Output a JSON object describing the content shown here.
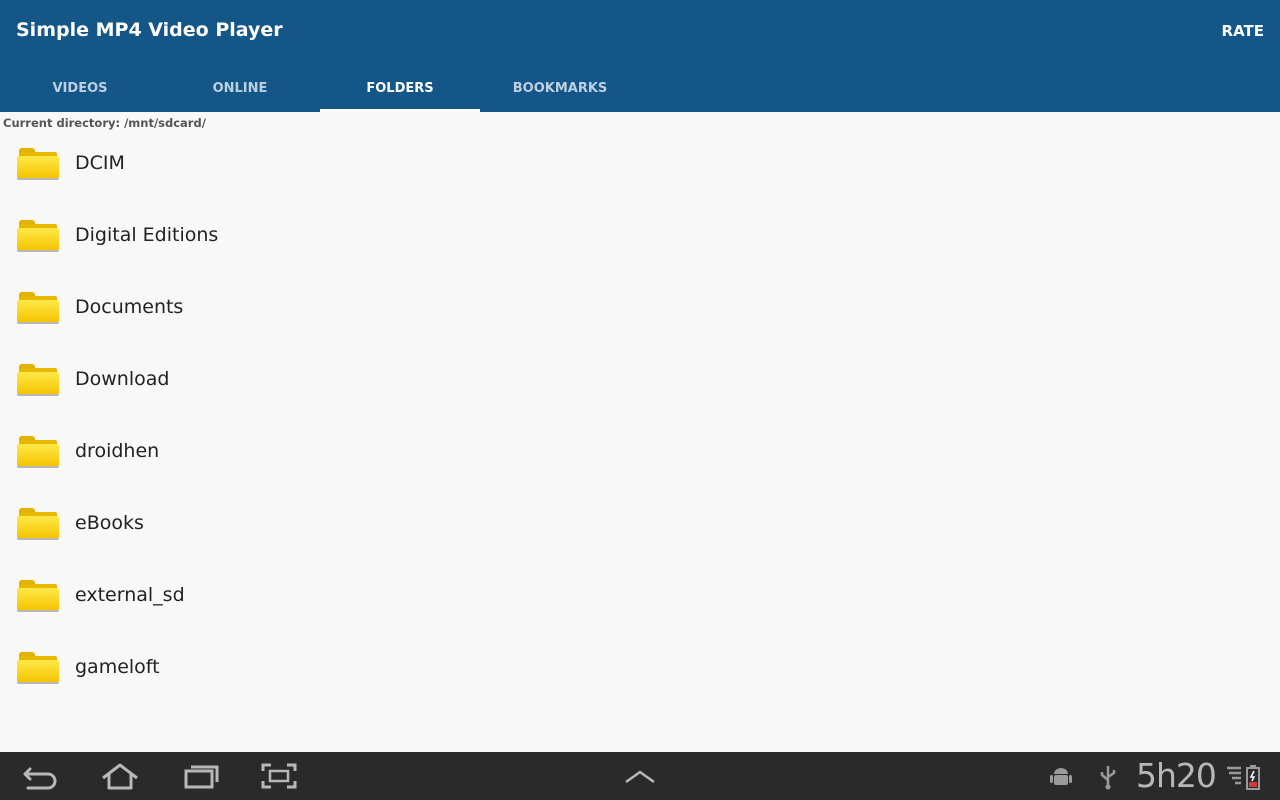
{
  "app": {
    "title": "Simple MP4 Video Player",
    "rate_label": "RATE"
  },
  "tabs": [
    {
      "label": "VIDEOS",
      "active": false
    },
    {
      "label": "ONLINE",
      "active": false
    },
    {
      "label": "FOLDERS",
      "active": true
    },
    {
      "label": "BOOKMARKS",
      "active": false
    }
  ],
  "current_directory": "Current directory: /mnt/sdcard/",
  "folders": [
    {
      "name": "DCIM",
      "icon": "folder-icon"
    },
    {
      "name": "Digital Editions",
      "icon": "folder-icon"
    },
    {
      "name": "Documents",
      "icon": "folder-icon"
    },
    {
      "name": "Download",
      "icon": "folder-icon"
    },
    {
      "name": "droidhen",
      "icon": "folder-icon"
    },
    {
      "name": "eBooks",
      "icon": "folder-icon"
    },
    {
      "name": "external_sd",
      "icon": "folder-icon"
    },
    {
      "name": "gameloft",
      "icon": "folder-icon"
    }
  ],
  "system_bar": {
    "clock": "5h20",
    "icons": [
      "back-icon",
      "home-icon",
      "recent-apps-icon",
      "screenshot-icon",
      "menu-up-icon",
      "android-debug-icon",
      "usb-icon",
      "signal-icon",
      "battery-icon"
    ]
  },
  "colors": {
    "appbar": "#135687",
    "tab_inactive": "#bcd0e2",
    "background": "#f8f8f8",
    "navbar": "#2a2a2a",
    "folder_yellow": "#f5c400"
  }
}
